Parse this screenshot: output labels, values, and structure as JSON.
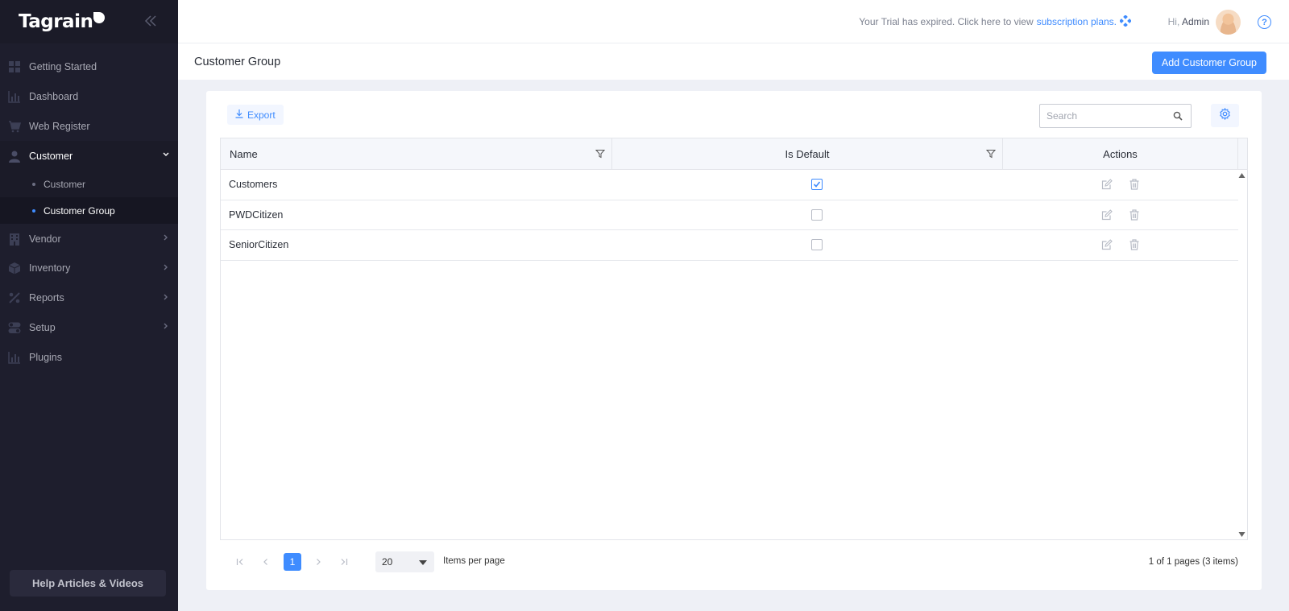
{
  "app": {
    "logo": "Tagrain"
  },
  "sidebar": {
    "items": [
      {
        "label": "Getting Started",
        "icon": "grid-icon"
      },
      {
        "label": "Dashboard",
        "icon": "bar-chart-icon"
      },
      {
        "label": "Web Register",
        "icon": "cart-icon"
      },
      {
        "label": "Customer",
        "icon": "user-icon",
        "open": true,
        "children": [
          {
            "label": "Customer"
          },
          {
            "label": "Customer Group",
            "active": true
          }
        ]
      },
      {
        "label": "Vendor",
        "icon": "building-icon"
      },
      {
        "label": "Inventory",
        "icon": "box-icon"
      },
      {
        "label": "Reports",
        "icon": "percent-icon"
      },
      {
        "label": "Setup",
        "icon": "toggle-icon"
      },
      {
        "label": "Plugins",
        "icon": "bar-chart-icon"
      }
    ],
    "help_label": "Help Articles & Videos"
  },
  "topbar": {
    "trial_text": "Your Trial has expired. Click here to view",
    "trial_link": "subscription plans.",
    "greeting": "Hi,",
    "user": "Admin"
  },
  "page": {
    "title": "Customer Group",
    "add_label": "Add Customer Group"
  },
  "toolbar": {
    "export_label": "Export",
    "search_placeholder": "Search"
  },
  "grid": {
    "columns": [
      "Name",
      "Is Default",
      "Actions"
    ],
    "rows": [
      {
        "name": "Customers",
        "is_default": true
      },
      {
        "name": "PWDCitizen",
        "is_default": false
      },
      {
        "name": "SeniorCitizen",
        "is_default": false
      }
    ]
  },
  "pager": {
    "current_page": "1",
    "page_size": "20",
    "items_per_page_label": "Items per page",
    "info": "1 of 1 pages (3 items)"
  },
  "colors": {
    "accent": "#3f8cff",
    "sidebar_bg": "#1e1e2d"
  }
}
